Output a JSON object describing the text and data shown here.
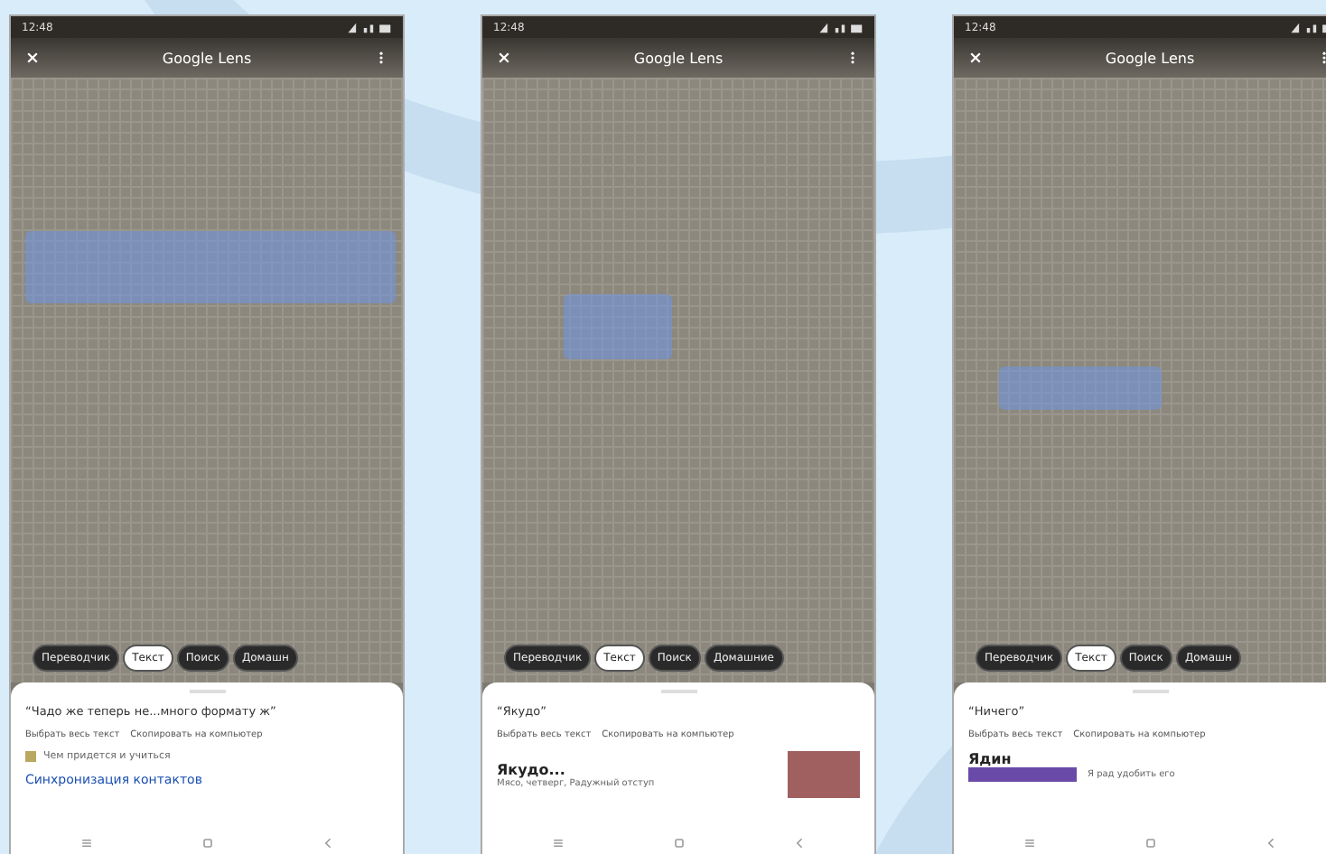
{
  "phones": [
    {
      "status_time": "12:48",
      "title": "Google Lens",
      "chips": [
        {
          "label": "Переводчик",
          "selected": false
        },
        {
          "label": "Текст",
          "selected": true
        },
        {
          "label": "Поиск",
          "selected": false
        },
        {
          "label": "Домашн",
          "selected": false
        }
      ],
      "query": "“Чадо же теперь не...много формату ж”",
      "actions": [
        "Выбрать весь текст",
        "Скопировать на компьютер"
      ],
      "results": [
        {
          "kind": "row",
          "text": "Чем придется и учиться"
        },
        {
          "kind": "link",
          "text": "Синхронизация контактов"
        }
      ]
    },
    {
      "status_time": "12:48",
      "title": "Google Lens",
      "chips": [
        {
          "label": "Переводчик",
          "selected": false
        },
        {
          "label": "Текст",
          "selected": true
        },
        {
          "label": "Поиск",
          "selected": false
        },
        {
          "label": "Домашние",
          "selected": false
        }
      ],
      "query": "“Якудо”",
      "actions": [
        "Выбрать весь текст",
        "Скопировать на компьютер"
      ],
      "results": [
        {
          "kind": "card",
          "text": "Якудо...",
          "subtitle": "Мясо, четверг, Радужный отступ"
        }
      ]
    },
    {
      "status_time": "12:48",
      "title": "Google Lens",
      "chips": [
        {
          "label": "Переводчик",
          "selected": false
        },
        {
          "label": "Текст",
          "selected": true
        },
        {
          "label": "Поиск",
          "selected": false
        },
        {
          "label": "Домашн",
          "selected": false
        }
      ],
      "query": "“Ничего”",
      "actions": [
        "Выбрать весь текст",
        "Скопировать на компьютер"
      ],
      "results": [
        {
          "kind": "strip",
          "text": "Ядин",
          "subtitle": "Я рад удобить его"
        }
      ]
    }
  ]
}
